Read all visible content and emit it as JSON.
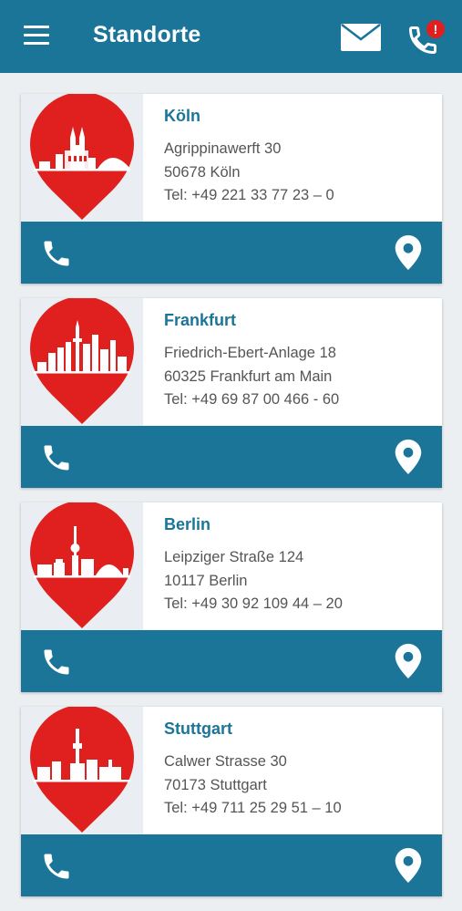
{
  "header": {
    "title": "Standorte",
    "menu_icon": "hamburger-menu-icon",
    "mail_icon": "mail-icon",
    "phone_alert_icon": "phone-alert-icon",
    "badge": "!"
  },
  "colors": {
    "primary": "#1a7599",
    "pin": "#e0201f",
    "card_bg": "#ffffff",
    "page_bg": "#eceff1"
  },
  "locations": [
    {
      "city": "Köln",
      "street": "Agrippinawerft 30",
      "postal": "50678 Köln",
      "phone": "Tel: +49 221 33 77 23 – 0"
    },
    {
      "city": "Frankfurt",
      "street": "Friedrich-Ebert-Anlage 18",
      "postal": "60325 Frankfurt am Main",
      "phone": "Tel: +49 69 87 00 466 - 60"
    },
    {
      "city": "Berlin",
      "street": "Leipziger Straße 124",
      "postal": "10117 Berlin",
      "phone": "Tel: +49 30 92 109 44 – 20"
    },
    {
      "city": "Stuttgart",
      "street": "Calwer Strasse 30",
      "postal": "70173 Stuttgart",
      "phone": "Tel: +49 711 25 29 51 – 10"
    }
  ]
}
